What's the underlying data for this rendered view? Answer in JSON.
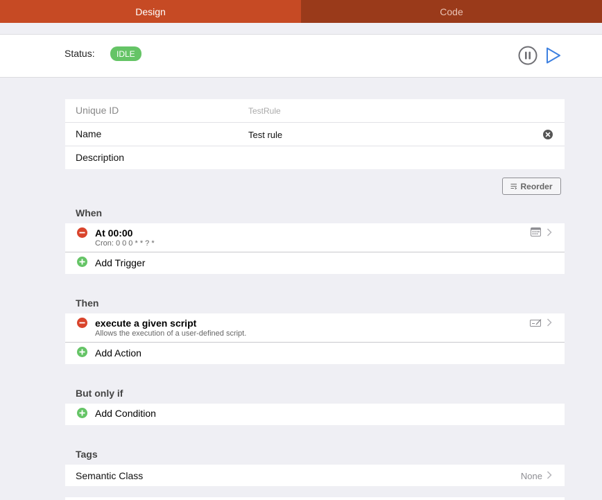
{
  "tabs": {
    "design": "Design",
    "code": "Code"
  },
  "status": {
    "label": "Status:",
    "value": "IDLE"
  },
  "rule": {
    "unique_id_label": "Unique ID",
    "unique_id_placeholder": "TestRule",
    "name_label": "Name",
    "name_value": "Test rule",
    "description_label": "Description"
  },
  "reorder_label": "Reorder",
  "when": {
    "title": "When",
    "trigger_title": "At 00:00",
    "trigger_sub": "Cron: 0 0 0 * * ? *",
    "add_label": "Add Trigger"
  },
  "then": {
    "title": "Then",
    "action_title": "execute a given script",
    "action_sub": "Allows the execution of a user-defined script.",
    "add_label": "Add Action"
  },
  "but_only_if": {
    "title": "But only if",
    "add_label": "Add Condition"
  },
  "tags": {
    "title": "Tags",
    "semantic_label": "Semantic Class",
    "semantic_value": "None"
  },
  "colors": {
    "accent": "#c64a24",
    "accent_dark": "#9a3a1a",
    "status_green": "#65c466",
    "remove_red": "#d9442c",
    "add_green": "#65c466",
    "play_blue": "#3d80e0"
  }
}
